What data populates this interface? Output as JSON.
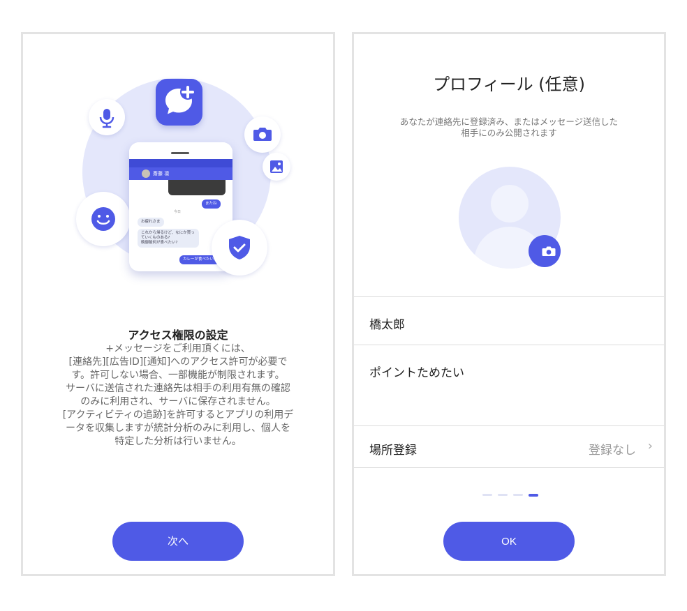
{
  "colors": {
    "accent": "#4f5ae6",
    "accent_light": "#e4e7fb",
    "border": "#e3e3e3"
  },
  "permission_screen": {
    "illustration": {
      "icons": [
        "plus-message-app-icon",
        "microphone-icon",
        "camera-icon",
        "image-icon",
        "smiley-icon",
        "shield-check-icon"
      ],
      "chat_contact": "斎藤 凛",
      "day_label": "今日",
      "messages": [
        {
          "text": "またね",
          "direction": "out"
        },
        {
          "text": "お疲れさま",
          "direction": "in"
        },
        {
          "text": "これから帰るけど、なにか買っていくものある?\n晩御飯何が食べたい?",
          "direction": "in"
        },
        {
          "text": "カレーが食べたいな。",
          "direction": "out"
        }
      ]
    },
    "title": "アクセス権限の設定",
    "body": "+メッセージをご利用頂くには、\n[連絡先][広告ID][通知]へのアクセス許可が必要で\nす。許可しない場合、一部機能が制限されます。\nサーバに送信された連絡先は相手の利用有無の確認\nのみに利用され、サーバに保存されません。\n[アクティビティの追跡]を許可するとアプリの利用デ\nータを収集しますが統計分析のみに利用し、個人を\n特定した分析は行いません。",
    "next_button": "次へ"
  },
  "profile_screen": {
    "title": "プロフィール (任意)",
    "subtitle": "あなたが連絡先に登録済み、またはメッセージ送信した\n相手にのみ公開されます",
    "avatar_icon": "default-avatar-icon",
    "camera_icon": "camera-icon",
    "name_value": "橋太郎",
    "status_value": "ポイントためたい",
    "location_label": "場所登録",
    "location_value": "登録なし",
    "page_indicator": {
      "total": 4,
      "current": 4
    },
    "ok_button": "OK"
  }
}
